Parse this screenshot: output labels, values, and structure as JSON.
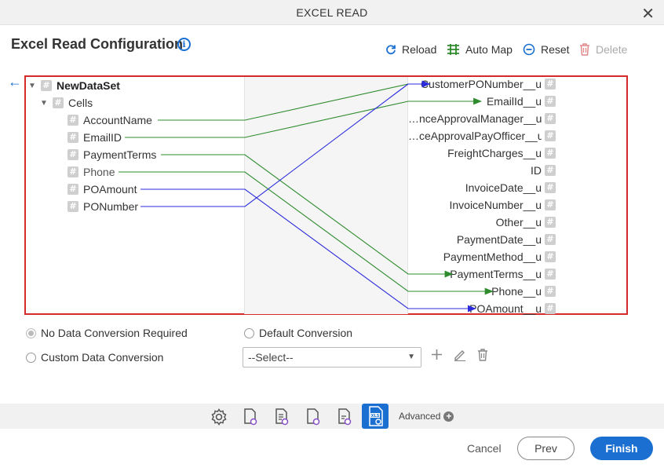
{
  "window": {
    "title": "EXCEL READ"
  },
  "page": {
    "title": "Excel Read Configuration"
  },
  "toolbar": {
    "reload": "Reload",
    "auto_map": "Auto Map",
    "reset": "Reset",
    "delete": "Delete"
  },
  "source_tree": {
    "root": "NewDataSet",
    "group": "Cells",
    "fields": [
      "AccountName",
      "EmailID",
      "PaymentTerms",
      "Phone",
      "POAmount",
      "PONumber"
    ]
  },
  "target_fields": [
    "CustomerPONumber__u",
    "EmailId__u",
    "…nceApprovalManager__u",
    "…ceApprovalPayOfficer__u",
    "FreightCharges__u",
    "ID",
    "InvoiceDate__u",
    "InvoiceNumber__u",
    "Other__u",
    "PaymentDate__u",
    "PaymentMethod__u",
    "PaymentTerms__u",
    "Phone__u",
    "POAmount__u"
  ],
  "mappings": [
    {
      "from": "AccountName",
      "to": "CustomerPONumber__u",
      "color": "#2e8b2e"
    },
    {
      "from": "EmailID",
      "to": "EmailId__u",
      "color": "#2e8b2e"
    },
    {
      "from": "PaymentTerms",
      "to": "PaymentTerms__u",
      "color": "#2e8b2e"
    },
    {
      "from": "Phone",
      "to": "Phone__u",
      "color": "#2e8b2e"
    },
    {
      "from": "POAmount",
      "to": "POAmount__u",
      "color": "#2b2bdc"
    },
    {
      "from": "PONumber",
      "to": "CustomerPONumber__u",
      "color": "#2b2bdc"
    }
  ],
  "conversion": {
    "no_conversion": "No Data Conversion Required",
    "default_conversion": "Default Conversion",
    "custom_conversion": "Custom Data Conversion",
    "selected": "no_conversion",
    "select_value": "--Select--"
  },
  "footer": {
    "advanced": "Advanced",
    "cancel": "Cancel",
    "prev": "Prev",
    "finish": "Finish"
  },
  "colors": {
    "accent": "#1a6fd1",
    "highlight_border": "#d42a2a",
    "map_green": "#2e8b2e",
    "map_blue": "#2b2bdc"
  }
}
